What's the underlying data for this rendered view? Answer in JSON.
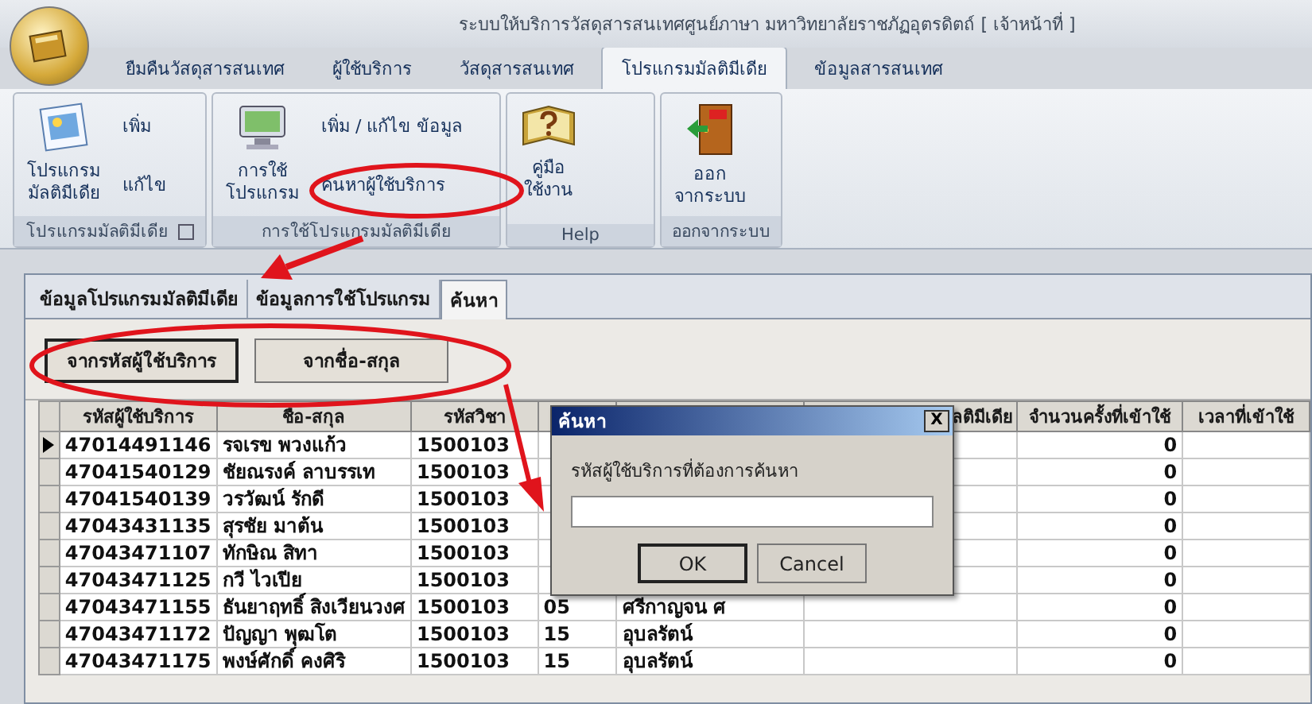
{
  "window": {
    "title": "ระบบให้บริการวัสดุสารสนเทศศูนย์ภาษา มหาวิทยาลัยราชภัฏอุตรดิตถ์ [ เจ้าหน้าที่ ]"
  },
  "ribbon_tabs": [
    {
      "label": "ยืมคืนวัสดุสารสนเทศ",
      "selected": false
    },
    {
      "label": "ผู้ใช้บริการ",
      "selected": false
    },
    {
      "label": "วัสดุสารสนเทศ",
      "selected": false
    },
    {
      "label": "โปรแกรมมัลติมีเดีย",
      "selected": true
    },
    {
      "label": "ข้อมูลสารสนเทศ",
      "selected": false
    }
  ],
  "ribbon_groups": [
    {
      "label": "โปรแกรมมัลติมีเดีย",
      "launcher": true,
      "large": {
        "label": "โปรแกรม\nมัลติมีเดีย"
      },
      "small": [
        "เพิ่ม",
        "แก้ไข"
      ]
    },
    {
      "label": "การใช้โปรแกรมมัลติมีเดีย",
      "launcher": false,
      "large": {
        "label": "การใช้\nโปรแกรม"
      },
      "small": [
        "เพิ่ม / แก้ไข ข้อมูล",
        "ค้นหาผู้ใช้บริการ"
      ]
    },
    {
      "label": "Help",
      "launcher": false,
      "large": {
        "label": "คู่มือ\nใช้งาน"
      }
    },
    {
      "label": "ออกจากระบบ",
      "launcher": false,
      "large": {
        "label": "ออก\nจากระบบ"
      }
    }
  ],
  "panel_tabs": [
    {
      "label": "ข้อมูลโปรแกรมมัลติมีเดีย",
      "selected": false
    },
    {
      "label": "ข้อมูลการใช้โปรแกรม",
      "selected": false
    },
    {
      "label": "ค้นหา",
      "selected": true
    }
  ],
  "search_buttons": [
    {
      "label": "จากรหัสผู้ใช้บริการ",
      "selected": true
    },
    {
      "label": "จากชื่อ-สกุล",
      "selected": false
    }
  ],
  "table": {
    "columns": {
      "user_id": "รหัสผู้ใช้บริการ",
      "name": "ชื่อ-สกุล",
      "course_code": "รหัสวิชา",
      "column_6": "ลติมีเดีย",
      "count": "จำนวนครั้งที่เข้าใช้",
      "time": "เวลาที่เข้าใช้"
    },
    "rows": [
      {
        "current": true,
        "user_id": "47014491146",
        "name": "รจเรข  พวงแก้ว",
        "course_code": "1500103",
        "count": "0"
      },
      {
        "current": false,
        "user_id": "47041540129",
        "name": "ชัยณรงค์   ลาบรรเท",
        "course_code": "1500103",
        "count": "0"
      },
      {
        "current": false,
        "user_id": "47041540139",
        "name": "วรวัฒน์  รักดี",
        "course_code": "1500103",
        "count": "0"
      },
      {
        "current": false,
        "user_id": "47043431135",
        "name": "สุรชัย  มาต้น",
        "course_code": "1500103",
        "count": "0"
      },
      {
        "current": false,
        "user_id": "47043471107",
        "name": "ทักษิณ  สิทา",
        "course_code": "1500103",
        "count": "0"
      },
      {
        "current": false,
        "user_id": "47043471125",
        "name": "กวี ไวเปีย",
        "course_code": "1500103",
        "count": "0"
      },
      {
        "current": false,
        "user_id": "47043471155",
        "name": "ธันยาฤทธิ์ สิงเวียนวงศ",
        "course_code": "1500103",
        "column_4": "05",
        "column_5": "ศรีกาญจน ศ",
        "count": "0"
      },
      {
        "current": false,
        "user_id": "47043471172",
        "name": "ปัญญา พุฒโต",
        "course_code": "1500103",
        "column_4": "15",
        "column_5": "อุบลรัตน์",
        "count": "0"
      },
      {
        "current": false,
        "user_id": "47043471175",
        "name": "พงษ์ศักดิ์  คงศิริ",
        "course_code": "1500103",
        "column_4": "15",
        "column_5": "อุบลรัตน์",
        "count": "0"
      }
    ]
  },
  "dialog": {
    "title": "ค้นหา",
    "close": "X",
    "label": "รหัสผู้ใช้บริการที่ต้องการค้นหา",
    "buttons": [
      {
        "label": "OK",
        "default": true
      },
      {
        "label": "Cancel",
        "default": false
      }
    ]
  }
}
